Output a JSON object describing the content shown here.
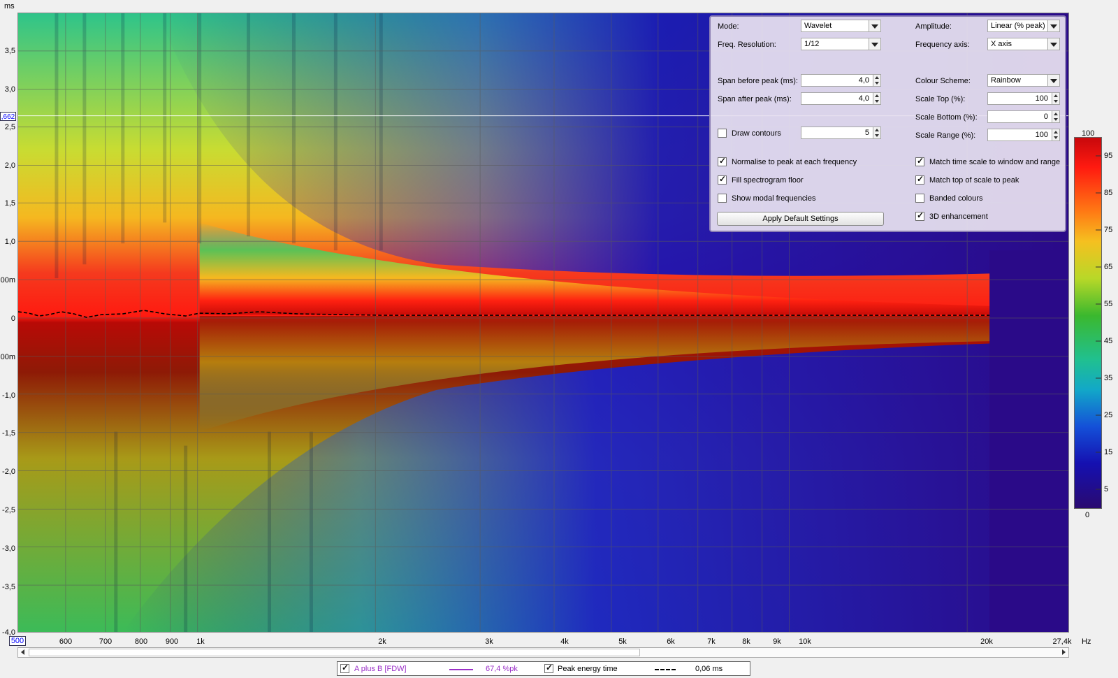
{
  "window": {
    "unit_label": "ms",
    "cursor_value": ",662",
    "x_start_value": "500",
    "x_unit": "Hz"
  },
  "y_axis": {
    "labels": [
      "3,5",
      "3,0",
      "2,5",
      "2,0",
      "1,5",
      "1,0",
      "00m",
      "0",
      "00m",
      "-1,0",
      "-1,5",
      "-2,0",
      "-2,5",
      "-3,0",
      "-3,5",
      "-4,0"
    ]
  },
  "x_axis": {
    "labels": [
      "600",
      "700",
      "800",
      "900",
      "1k",
      "2k",
      "3k",
      "4k",
      "5k",
      "6k",
      "7k",
      "8k",
      "9k",
      "10k",
      "20k",
      "27,4k"
    ]
  },
  "panel": {
    "mode_label": "Mode:",
    "mode_value": "Wavelet",
    "freq_res_label": "Freq. Resolution:",
    "freq_res_value": "1/12",
    "span_before_label": "Span before peak (ms):",
    "span_before_value": "4,0",
    "span_after_label": "Span after peak (ms):",
    "span_after_value": "4,0",
    "draw_contours_label": "Draw contours",
    "draw_contours_value": "5",
    "normalise_label": "Normalise to peak at each frequency",
    "fill_floor_label": "Fill spectrogram floor",
    "modal_label": "Show modal frequencies",
    "apply_default_label": "Apply Default Settings",
    "amplitude_label": "Amplitude:",
    "amplitude_value": "Linear (% peak)",
    "freq_axis_label": "Frequency axis:",
    "freq_axis_value": "X axis",
    "colour_scheme_label": "Colour Scheme:",
    "colour_scheme_value": "Rainbow",
    "scale_top_label": "Scale Top (%):",
    "scale_top_value": "100",
    "scale_bottom_label": "Scale Bottom (%):",
    "scale_bottom_value": "0",
    "scale_range_label": "Scale Range (%):",
    "scale_range_value": "100",
    "match_time_label": "Match time scale to window and range",
    "match_top_label": "Match top of scale to peak",
    "banded_label": "Banded colours",
    "enhance_label": "3D enhancement",
    "checks": {
      "draw_contours": false,
      "normalise": true,
      "fill_floor": true,
      "modal": false,
      "match_time": true,
      "match_top": true,
      "banded": false,
      "enhance": true
    }
  },
  "colorbar": {
    "top_label": "100",
    "bottom_label": "0",
    "ticks": [
      "95",
      "85",
      "75",
      "65",
      "55",
      "45",
      "35",
      "25",
      "15",
      "5"
    ]
  },
  "legend": {
    "series_name": "A plus B [FDW]",
    "series_value": "67,4 %pk",
    "peak_label": "Peak energy time",
    "peak_value": "0,06 ms",
    "series_color": "#9b30c8"
  }
}
